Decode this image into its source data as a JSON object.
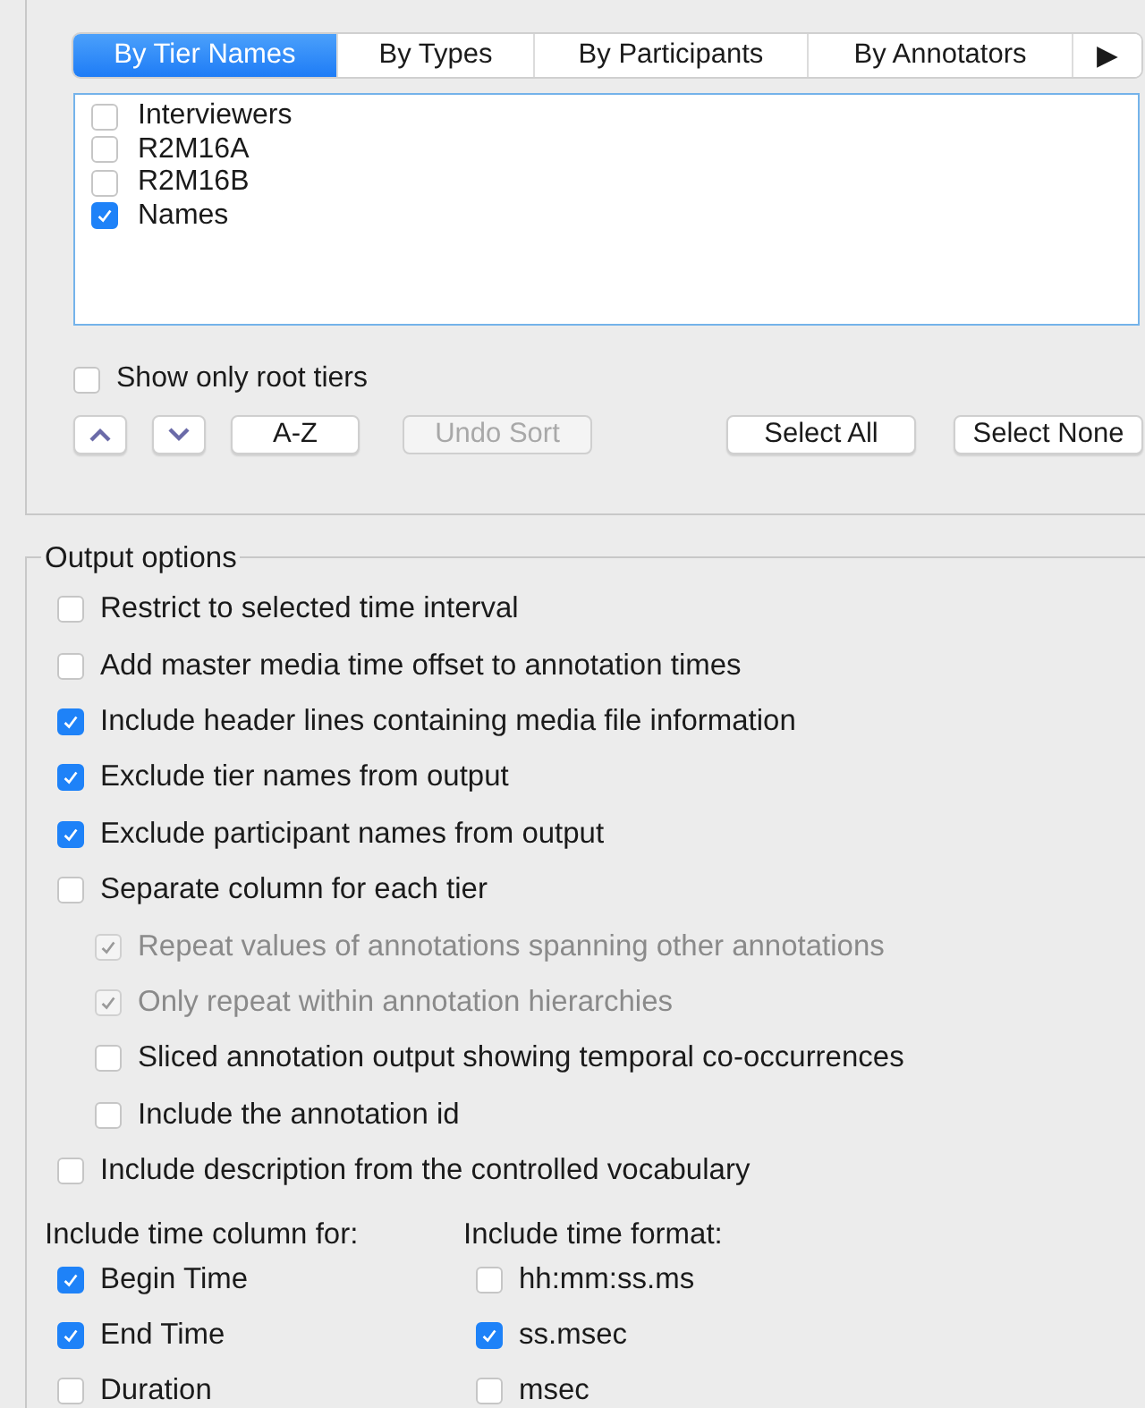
{
  "tabs": [
    {
      "label": "By Tier Names",
      "selected": true
    },
    {
      "label": "By Types",
      "selected": false
    },
    {
      "label": "By Participants",
      "selected": false
    },
    {
      "label": "By Annotators",
      "selected": false
    }
  ],
  "tab_scroll": "▶",
  "tiers": [
    {
      "label": "Interviewers",
      "checked": false
    },
    {
      "label": "R2M16A",
      "checked": false
    },
    {
      "label": "R2M16B",
      "checked": false
    },
    {
      "label": "Names",
      "checked": true
    }
  ],
  "show_root": {
    "label": "Show only root tiers",
    "checked": false
  },
  "sort_buttons": [
    {
      "label": "A-Z",
      "disabled": false
    },
    {
      "label": "Undo Sort",
      "disabled": true
    }
  ],
  "select_buttons": [
    {
      "label": "Select All"
    },
    {
      "label": "Select None"
    }
  ],
  "output_options": {
    "title": "Output options",
    "options": [
      {
        "label": "Restrict to selected time interval",
        "checked": false,
        "disabled": false
      },
      {
        "label": "Add master media time offset to annotation times",
        "checked": false,
        "disabled": false
      },
      {
        "label": "Include header lines containing media file information",
        "checked": true,
        "disabled": false
      },
      {
        "label": "Exclude tier names from output",
        "checked": true,
        "disabled": false
      },
      {
        "label": "Exclude participant names from output",
        "checked": true,
        "disabled": false
      },
      {
        "label": "Separate column for each tier",
        "checked": false,
        "disabled": false,
        "children": [
          {
            "label": "Repeat values of annotations spanning other annotations",
            "checked": true,
            "disabled": true
          },
          {
            "label": "Only repeat within annotation hierarchies",
            "checked": true,
            "disabled": true
          },
          {
            "label": "Sliced annotation output showing temporal co-occurrences",
            "checked": false,
            "disabled": false
          },
          {
            "label": "Include the annotation id",
            "checked": false,
            "disabled": false
          }
        ]
      },
      {
        "label": "Include description from the controlled vocabulary",
        "checked": false,
        "disabled": false
      }
    ],
    "time_columns": {
      "title": "Include time column for:",
      "items": [
        {
          "label": "Begin Time",
          "checked": true
        },
        {
          "label": "End Time",
          "checked": true
        },
        {
          "label": "Duration",
          "checked": false
        }
      ]
    },
    "time_formats": {
      "title": "Include time format:",
      "items": [
        {
          "label": "hh:mm:ss.ms",
          "checked": false
        },
        {
          "label": "ss.msec",
          "checked": true
        },
        {
          "label": "msec",
          "checked": false
        }
      ]
    }
  }
}
